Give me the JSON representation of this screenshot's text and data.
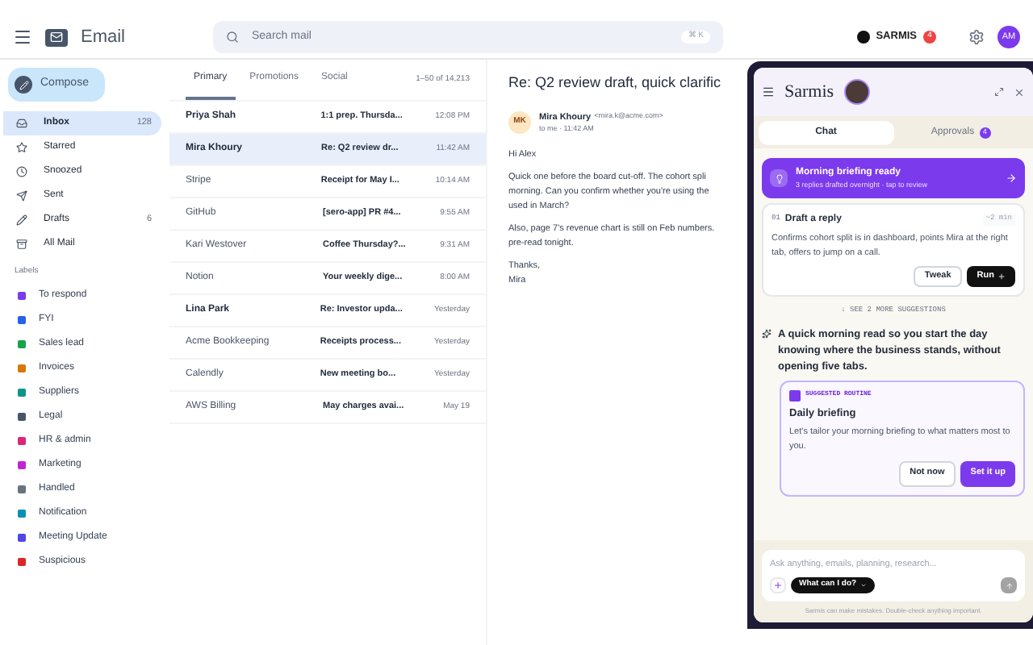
{
  "app": {
    "title": "Email"
  },
  "search": {
    "placeholder": "Search mail",
    "shortcut": "⌘ K"
  },
  "account": {
    "assistant": "SARMIS",
    "badge": "4",
    "initials": "AM"
  },
  "compose": "Compose",
  "folders": [
    {
      "name": "Inbox",
      "count": "128",
      "selected": true
    },
    {
      "name": "Starred",
      "selected": false
    },
    {
      "name": "Snoozed",
      "selected": false
    },
    {
      "name": "Sent",
      "selected": false
    },
    {
      "name": "Drafts",
      "count": "6",
      "selected": false
    },
    {
      "name": "All Mail",
      "selected": false
    }
  ],
  "labels_heading": "Labels",
  "labels": [
    {
      "name": "To respond",
      "color": "#7c3aed"
    },
    {
      "name": "FYI",
      "color": "#2563eb"
    },
    {
      "name": "Sales lead",
      "color": "#16a34a"
    },
    {
      "name": "Invoices",
      "color": "#d97706"
    },
    {
      "name": "Suppliers",
      "color": "#0d9488"
    },
    {
      "name": "Legal",
      "color": "#475569"
    },
    {
      "name": "HR & admin",
      "color": "#db2777"
    },
    {
      "name": "Marketing",
      "color": "#c026d3"
    },
    {
      "name": "Handled",
      "color": "#6b7280"
    },
    {
      "name": "Notification",
      "color": "#0891b2"
    },
    {
      "name": "Meeting Update",
      "color": "#4f46e5"
    },
    {
      "name": "Suspicious",
      "color": "#dc2626"
    }
  ],
  "tabs": [
    {
      "label": "Primary",
      "selected": true
    },
    {
      "label": "Promotions",
      "selected": false
    },
    {
      "label": "Social",
      "selected": false
    }
  ],
  "range": "1–50 of 14,213",
  "messages": [
    {
      "sender": "Priya Shah",
      "subject": "1:1 prep. Thursda...",
      "time": "12:08 PM",
      "unread": true,
      "selected": false
    },
    {
      "sender": "Mira Khoury",
      "subject": "Re: Q2 review dr...",
      "time": "11:42 AM",
      "unread": true,
      "selected": true
    },
    {
      "sender": "Stripe",
      "subject": "Receipt for May I...",
      "time": "10:14 AM",
      "unread": false,
      "selected": false
    },
    {
      "sender": "GitHub",
      "subject": "[sero-app] PR #4...",
      "time": "9:55 AM",
      "unread": false,
      "selected": false
    },
    {
      "sender": "Kari Westover",
      "subject": "Coffee Thursday?...",
      "time": "9:31 AM",
      "unread": false,
      "selected": false
    },
    {
      "sender": "Notion",
      "subject": "Your weekly dige...",
      "time": "8:00 AM",
      "unread": false,
      "selected": false
    },
    {
      "sender": "Lina Park",
      "subject": "Re: Investor upda...",
      "time": "Yesterday",
      "unread": true,
      "selected": false
    },
    {
      "sender": "Acme Bookkeeping",
      "subject": "Receipts process...",
      "time": "Yesterday",
      "unread": false,
      "selected": false
    },
    {
      "sender": "Calendly",
      "subject": "New meeting bo...",
      "time": "Yesterday",
      "unread": false,
      "selected": false
    },
    {
      "sender": "AWS Billing",
      "subject": "May charges avai...",
      "time": "May 19",
      "unread": false,
      "selected": false
    }
  ],
  "reading": {
    "subject": "Re: Q2 review draft, quick clarific",
    "avatar": "MK",
    "from_name": "Mira Khoury",
    "from_email": "<mira.k@acme.com>",
    "meta": "to me · 11:42 AM",
    "body": [
      "Hi Alex",
      "Quick one before the board cut-off. The cohort spli",
      "morning. Can you confirm whether you're using the",
      "used in March?",
      "Also, page 7's revenue chart is still on Feb numbers.",
      "pre-read tonight.",
      "Thanks,",
      "Mira"
    ]
  },
  "assistant": {
    "name": "Sarmis",
    "tabs": [
      {
        "label": "Chat",
        "selected": true
      },
      {
        "label": "Approvals",
        "badge": "4",
        "selected": false
      }
    ],
    "briefing": {
      "title": "Morning briefing ready",
      "subtitle": "3 replies drafted overnight · tap to review"
    },
    "suggestion": {
      "number": "01",
      "title": "Draft a reply",
      "eta": "~2 min",
      "text": "Confirms cohort split is in dashboard, points Mira at the right tab, offers to jump on a call.",
      "buttons": [
        "Tweak",
        "Run"
      ]
    },
    "more": "↓ SEE 2 MORE SUGGESTIONS",
    "message": "A quick morning read so you start the day knowing where the business stands, without opening five tabs.",
    "routine": {
      "tag": "SUGGESTED ROUTINE",
      "title": "Daily briefing",
      "text": "Let's tailor your morning briefing to what matters most to you.",
      "buttons": [
        "Not now",
        "Set it up"
      ]
    },
    "input": {
      "placeholder": "Ask anything, emails, planning, research...",
      "chip": "What can I do?"
    },
    "disclaimer": "Sarmis can make mistakes. Double-check anything important."
  }
}
